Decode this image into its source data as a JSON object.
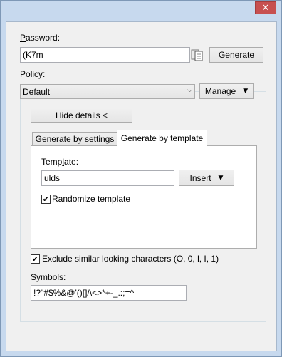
{
  "window": {
    "close_glyph": "✕"
  },
  "password": {
    "label_key": "P",
    "label_rest": "assword:",
    "value": "(K7m",
    "copy_icon": "copy-icon",
    "generate_label": "Generate"
  },
  "policy": {
    "label_pre": "P",
    "label_key": "o",
    "label_rest": "licy:",
    "selected": "Default",
    "manage_label": "Manage"
  },
  "details": {
    "hide_label": "Hide details <",
    "tabs": [
      "Generate by settings",
      "Generate by template"
    ],
    "active_tab": 1,
    "template": {
      "label_pre": "Temp",
      "label_key": "l",
      "label_rest": "ate:",
      "value": "ulds",
      "insert_label": "Insert"
    },
    "randomize_label": "Randomize template",
    "randomize_checked": true
  },
  "exclude": {
    "label": "Exclude similar looking characters (O, 0, l, I, 1)",
    "checked": true
  },
  "symbols": {
    "label_pre": "S",
    "label_key": "y",
    "label_rest": "mbols:",
    "value": "!?\"#$%&@'()[]/\\<>*+-_.:;=^"
  },
  "colors": {
    "close_bg": "#c75050",
    "titlebar": "#c7d9ee",
    "panel_bg": "#f0f0f0"
  }
}
